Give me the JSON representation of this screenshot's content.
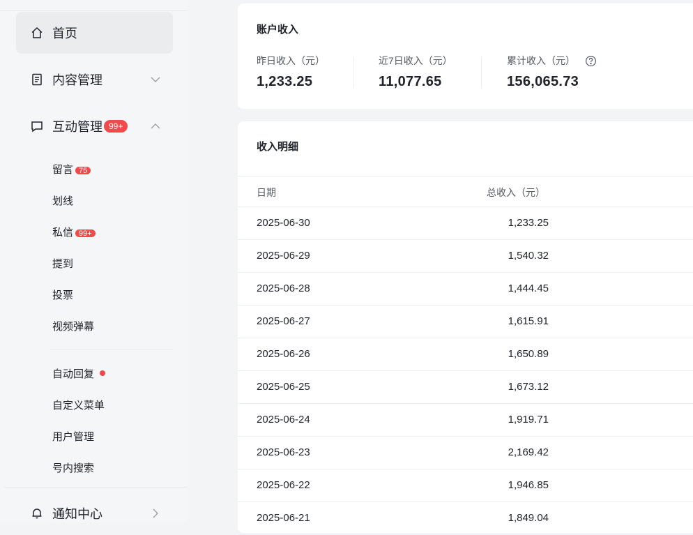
{
  "sidebar": {
    "home": {
      "label": "首页",
      "icon": "home-icon"
    },
    "content": {
      "label": "内容管理",
      "icon": "document-icon"
    },
    "interaction": {
      "label": "互动管理",
      "icon": "chat-bubble-icon",
      "badge": "99+"
    },
    "sub_items": [
      {
        "label": "留言",
        "badge": "75"
      },
      {
        "label": "划线"
      },
      {
        "label": "私信",
        "badge": "99+"
      },
      {
        "label": "提到"
      },
      {
        "label": "投票"
      },
      {
        "label": "视频弹幕"
      }
    ],
    "sub_items_2": [
      {
        "label": "自动回复",
        "dot": true
      },
      {
        "label": "自定义菜单"
      },
      {
        "label": "用户管理"
      },
      {
        "label": "号内搜索"
      }
    ],
    "notifications": {
      "label": "通知中心",
      "icon": "bell-icon"
    }
  },
  "account_income": {
    "title": "账户收入",
    "stats": [
      {
        "label": "昨日收入（元）",
        "value": "1,233.25"
      },
      {
        "label": "近7日收入（元）",
        "value": "11,077.65"
      },
      {
        "label": "累计收入（元）",
        "value": "156,065.73"
      }
    ]
  },
  "income_details": {
    "title": "收入明细",
    "columns": [
      "日期",
      "总收入（元）"
    ],
    "rows": [
      {
        "date": "2025-06-30",
        "amount": "1,233.25"
      },
      {
        "date": "2025-06-29",
        "amount": "1,540.32"
      },
      {
        "date": "2025-06-28",
        "amount": "1,444.45"
      },
      {
        "date": "2025-06-27",
        "amount": "1,615.91"
      },
      {
        "date": "2025-06-26",
        "amount": "1,650.89"
      },
      {
        "date": "2025-06-25",
        "amount": "1,673.12"
      },
      {
        "date": "2025-06-24",
        "amount": "1,919.71"
      },
      {
        "date": "2025-06-23",
        "amount": "2,169.42"
      },
      {
        "date": "2025-06-22",
        "amount": "1,946.85"
      },
      {
        "date": "2025-06-21",
        "amount": "1,849.04"
      }
    ]
  },
  "colors": {
    "badge": "#f04a4a",
    "accent_bg": "#ebecee"
  }
}
